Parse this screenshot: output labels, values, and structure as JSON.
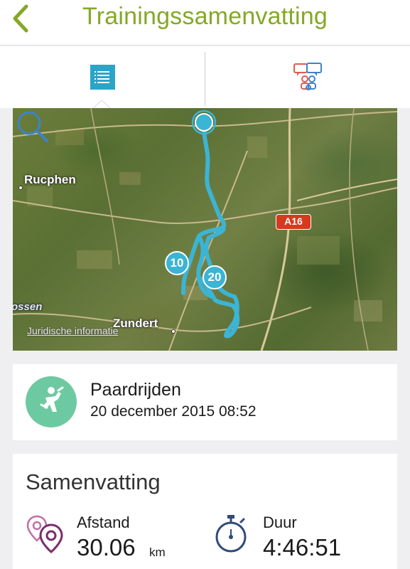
{
  "header": {
    "title": "Trainingssamenvatting",
    "back_icon": "chevron-left-icon",
    "accent_color": "#85a826"
  },
  "tabs": [
    {
      "icon": "list-icon",
      "selected": true
    },
    {
      "icon": "social-share-icon",
      "selected": false
    }
  ],
  "map": {
    "places": [
      "Rucphen",
      "Zundert",
      "ossen"
    ],
    "road_badge": "A16",
    "km_markers": [
      "10",
      "20"
    ],
    "legal_link": "Juridische informatie",
    "route_color": "#3cb4d4"
  },
  "activity": {
    "icon": "horse-riding-icon",
    "name": "Paardrijden",
    "date": "20 december 2015 08:52"
  },
  "summary": {
    "title": "Samenvatting",
    "distance": {
      "label": "Afstand",
      "value": "30.06",
      "unit": "km",
      "icon": "location-pins-icon"
    },
    "duration": {
      "label": "Duur",
      "value": "4:46:51",
      "icon": "stopwatch-icon"
    }
  }
}
